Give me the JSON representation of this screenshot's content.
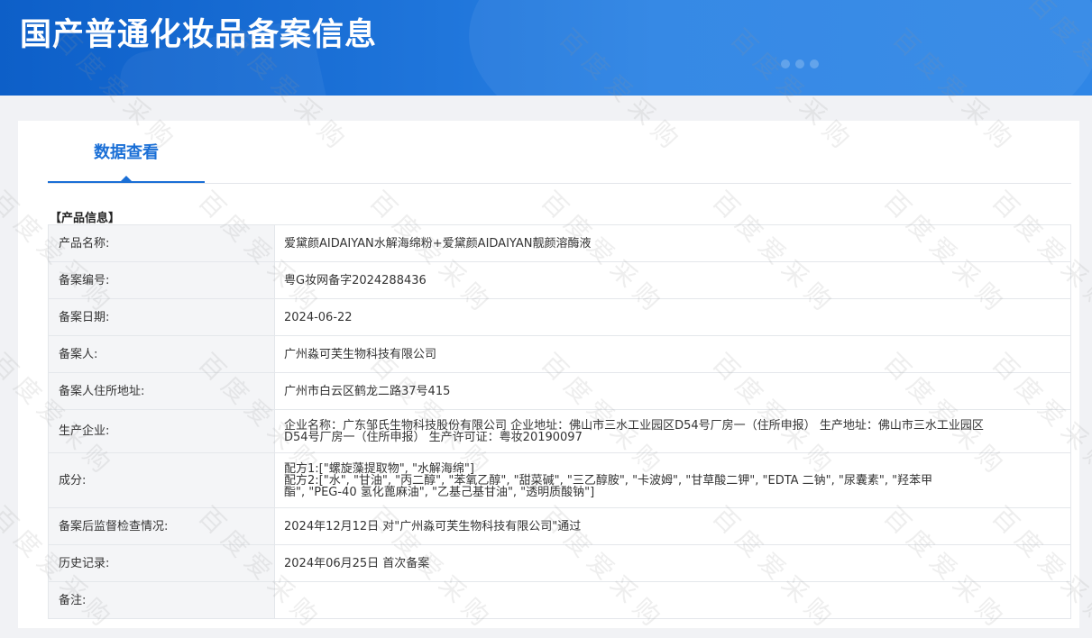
{
  "header": {
    "title": "国产普通化妆品备案信息"
  },
  "tabs": [
    {
      "label": "数据查看",
      "active": true
    }
  ],
  "section": {
    "title": "【产品信息】"
  },
  "rows": [
    {
      "label": "产品名称:",
      "value": "爱黛颜AIDAIYAN水解海绵粉+爱黛颜AIDAIYAN靓颜溶酶液"
    },
    {
      "label": "备案编号:",
      "value": "粤G妆网备字2024288436"
    },
    {
      "label": "备案日期:",
      "value": "2024-06-22"
    },
    {
      "label": "备案人:",
      "value": "广州淼可芙生物科技有限公司"
    },
    {
      "label": "备案人住所地址:",
      "value": "广州市白云区鹤龙二路37号415"
    },
    {
      "label": "生产企业:",
      "lines": [
        "企业名称：广东邹氏生物科技股份有限公司 企业地址：佛山市三水工业园区D54号厂房一（住所申报） 生产地址：佛山市三水工业园区",
        "D54号厂房一（住所申报） 生产许可证：粤妆20190097"
      ]
    },
    {
      "label": "成分:",
      "lines": [
        "配方1:[\"螺旋藻提取物\", \"水解海绵\"]",
        "配方2:[\"水\", \"甘油\", \"丙二醇\", \"苯氧乙醇\", \"甜菜碱\", \"三乙醇胺\", \"卡波姆\", \"甘草酸二钾\", \"EDTA 二钠\", \"尿囊素\", \"羟苯甲",
        "酯\", \"PEG-40 氢化蓖麻油\", \"乙基己基甘油\", \"透明质酸钠\"]"
      ]
    },
    {
      "label": "备案后监督检查情况:",
      "value": "2024年12月12日 对\"广州淼可芙生物科技有限公司\"通过"
    },
    {
      "label": "历史记录:",
      "value": "2024年06月25日 首次备案"
    },
    {
      "label": "备注:",
      "value": ""
    }
  ],
  "watermark": {
    "text": "百度爱采购"
  },
  "colors": {
    "accent": "#1a6fd6",
    "banner": "#1a6fd6",
    "label_bg": "#f4f5f7",
    "table_border": "#aac3e4"
  }
}
